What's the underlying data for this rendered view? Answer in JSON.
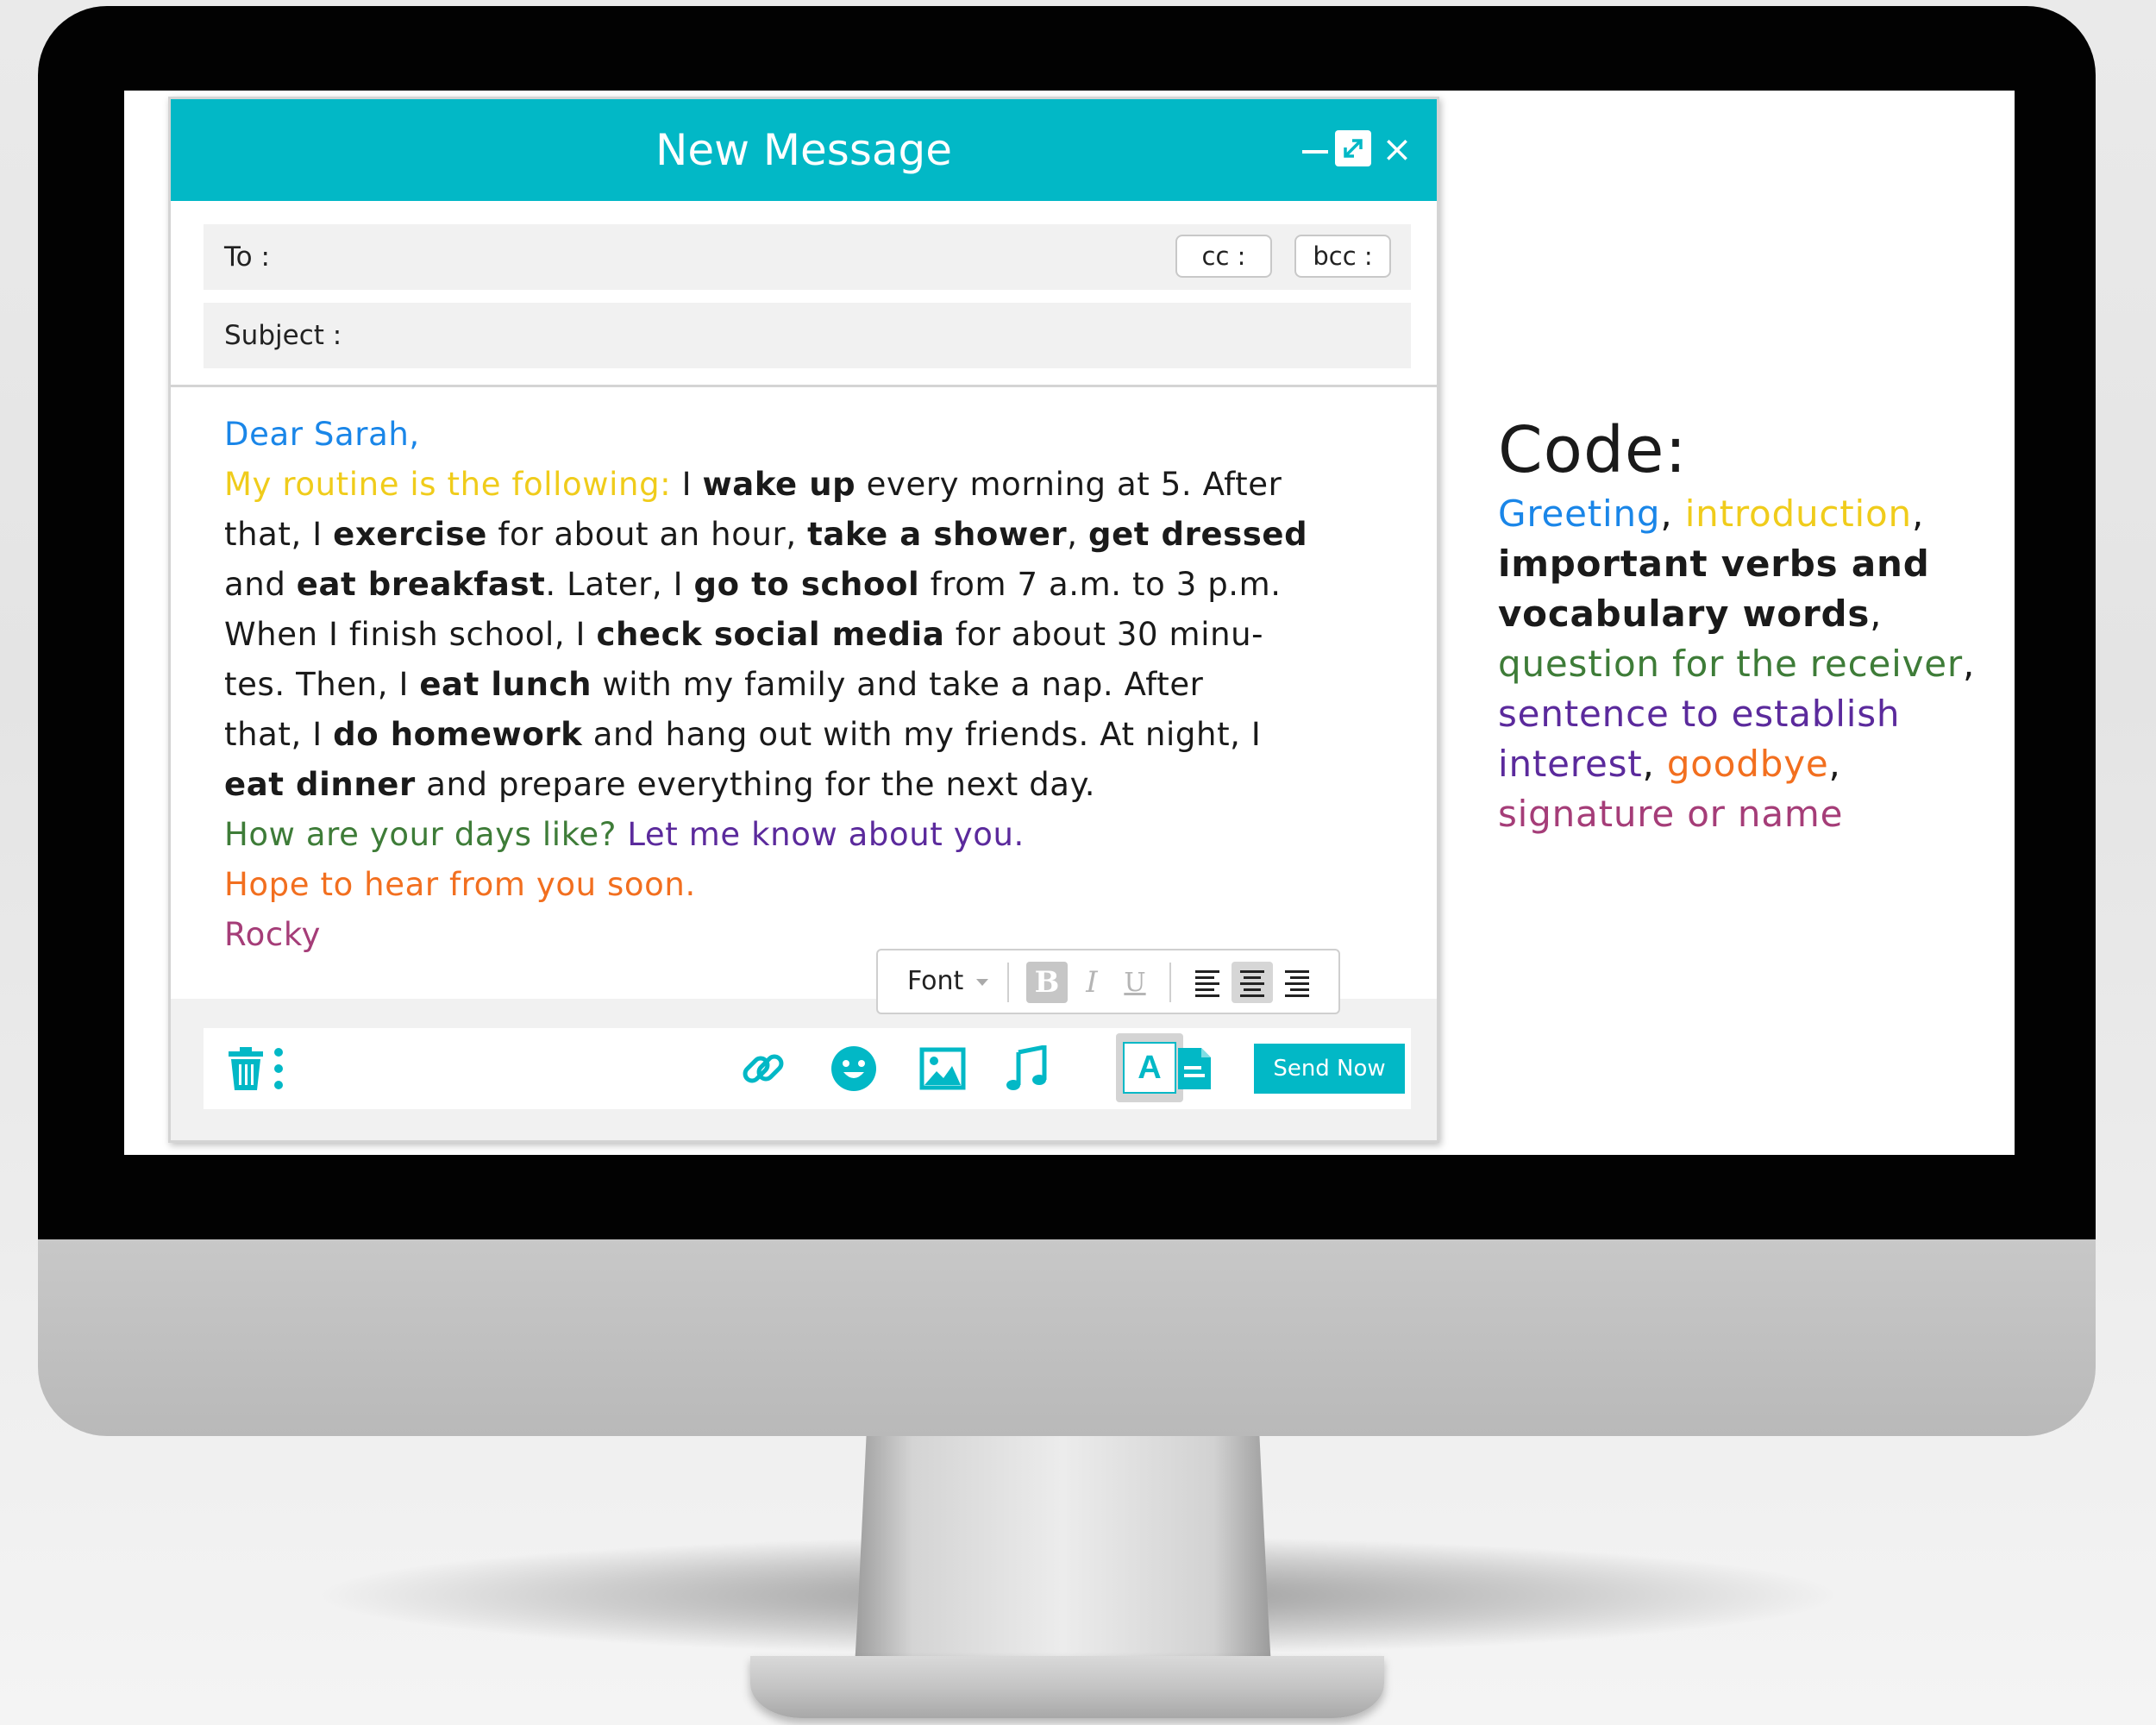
{
  "window": {
    "title": "New Message",
    "minimize_icon": "minimize-icon",
    "maximize_icon": "expand-icon",
    "close_glyph": "×"
  },
  "fields": {
    "to_label": "To :",
    "cc_label": "cc :",
    "bcc_label": "bcc :",
    "subject_label": "Subject  :"
  },
  "message": {
    "greeting": "Dear Sarah,",
    "introduction": "My routine is the following:",
    "line1_a": " I ",
    "line1_b": "wake up",
    "line1_c": " every morning at 5. After",
    "line2_a": "that, I ",
    "line2_b": "exercise",
    "line2_c": " for about an hour, ",
    "line2_d": "take a shower",
    "line2_e": ", ",
    "line2_f": "get dressed",
    "line3_a": "and ",
    "line3_b": "eat breakfast",
    "line3_c": ". Later, I ",
    "line3_d": "go to school",
    "line3_e": " from 7 a.m. to 3 p.m.",
    "line4_a": "When I finish school, I ",
    "line4_b": "check social media",
    "line4_c": " for about 30 minu-",
    "line5_a": "tes. Then, I ",
    "line5_b": "eat lunch",
    "line5_c": " with my family and take a nap. After",
    "line6_a": "that, I ",
    "line6_b": "do homework",
    "line6_c": " and hang out with my friends. At night, I",
    "line7_a": "eat dinner",
    "line7_b": " and prepare everything for the next day.",
    "question": "How are your days like?",
    "interest": " Let me know about you.",
    "goodbye": "Hope to hear from you soon.",
    "signature": "Rocky"
  },
  "format_toolbar": {
    "font_label": "Font",
    "bold": "B",
    "italic": "I",
    "underline": "U",
    "active_alignment": "center"
  },
  "actions": {
    "trash_icon": "trash-icon",
    "more_icon": "more-vertical-icon",
    "attach_icon": "link-icon",
    "emoji_icon": "smiley-icon",
    "image_icon": "image-icon",
    "audio_icon": "music-note-icon",
    "text_format_label": "A",
    "document_icon": "document-icon",
    "send_label": "Send Now"
  },
  "legend": {
    "title": "Code:",
    "greeting": "Greeting",
    "sep1": ", ",
    "introduction": "introduction",
    "sep2": ",",
    "important": "important verbs and vocabulary words",
    "sep3": ",",
    "question": "question for the receiver",
    "sep4": ", ",
    "interest": "sentence to establish interest",
    "sep5": ",",
    "goodbye": "goodbye",
    "sep6": ", ",
    "signature": "signature or name"
  },
  "colors": {
    "accent": "#02b8c6",
    "greeting": "#1a86e8",
    "introduction": "#f0cc1b",
    "important": "#1a1a1a",
    "question": "#3e7c38",
    "interest": "#5b2a9c",
    "goodbye": "#f26f1f",
    "signature": "#a53d78"
  }
}
